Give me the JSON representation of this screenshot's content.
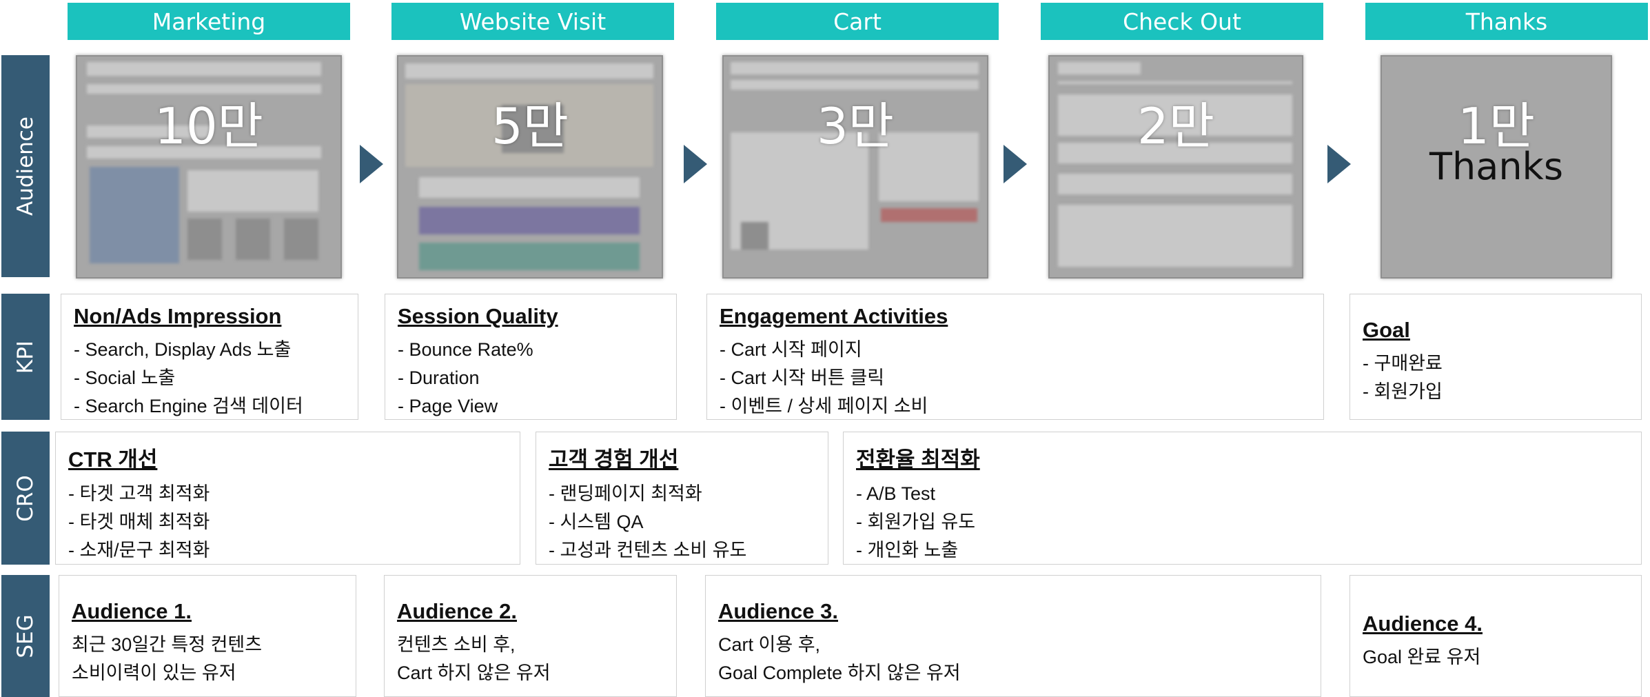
{
  "stages": [
    "Marketing",
    "Website Visit",
    "Cart",
    "Check Out",
    "Thanks"
  ],
  "rows": [
    "Audience",
    "KPI",
    "CRO",
    "SEG"
  ],
  "audience": [
    {
      "count": "10만"
    },
    {
      "count": "5만"
    },
    {
      "count": "3만"
    },
    {
      "count": "2만"
    },
    {
      "count": "1만",
      "label": "Thanks"
    }
  ],
  "kpi": [
    {
      "title": "Non/Ads Impression",
      "items": [
        "- Search, Display Ads 노출",
        "- Social 노출",
        "- Search Engine 검색 데이터"
      ]
    },
    {
      "title": "Session Quality",
      "items": [
        "- Bounce Rate%",
        "- Duration",
        "- Page View"
      ]
    },
    {
      "title": "Engagement Activities",
      "items": [
        "- Cart 시작 페이지",
        "- Cart 시작 버튼 클릭",
        "- 이벤트 / 상세 페이지 소비"
      ]
    },
    {
      "title": "Goal",
      "items": [
        "- 구매완료",
        "- 회원가입"
      ]
    }
  ],
  "cro": [
    {
      "title": "CTR 개선",
      "items": [
        "- 타겟 고객 최적화",
        "- 타겟 매체 최적화",
        "- 소재/문구 최적화"
      ]
    },
    {
      "title": "고객 경험 개선",
      "items": [
        "- 랜딩페이지 최적화",
        "- 시스템 QA",
        "- 고성과 컨텐츠 소비 유도"
      ]
    },
    {
      "title": "전환율 최적화",
      "items": [
        "- A/B Test",
        "- 회원가입 유도",
        "- 개인화 노출"
      ]
    }
  ],
  "seg": [
    {
      "title": "Audience 1.",
      "items": [
        "최근 30일간 특정 컨텐츠",
        "소비이력이 있는 유저"
      ]
    },
    {
      "title": "Audience 2.",
      "items": [
        "컨텐츠 소비 후,",
        "Cart 하지 않은 유저"
      ]
    },
    {
      "title": "Audience 3.",
      "items": [
        "Cart 이용 후,",
        "Goal Complete 하지 않은 유저"
      ]
    },
    {
      "title": "Audience 4.",
      "items": [
        "Goal 완료 유저"
      ]
    }
  ],
  "colors": {
    "stage": "#1bc2be",
    "label": "#355b75",
    "shot": "#a7a7a7"
  }
}
